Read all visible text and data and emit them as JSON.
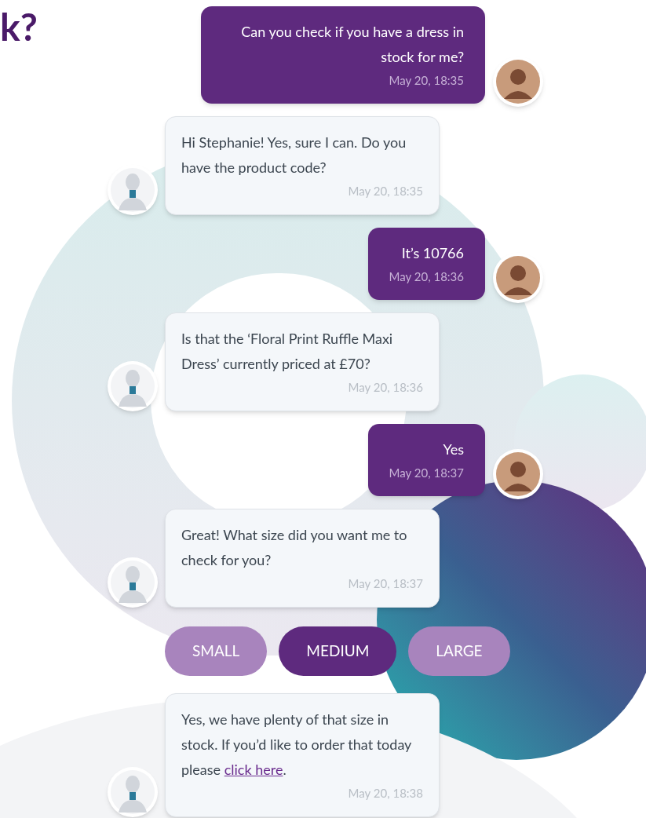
{
  "heading": "k?",
  "messages": [
    {
      "kind": "sent",
      "text": "Can you check if you have a dress in stock for me?",
      "time": "May 20, 18:35"
    },
    {
      "kind": "received",
      "text": "Hi Stephanie! Yes, sure I can. Do you have the product code?",
      "time": "May 20, 18:35"
    },
    {
      "kind": "sent",
      "text": "It’s 10766",
      "time": "May 20, 18:36"
    },
    {
      "kind": "received",
      "text": "Is that the ‘Floral Print Ruffle Maxi Dress’ currently priced at £70?",
      "time": "May 20, 18:36"
    },
    {
      "kind": "sent",
      "text": "Yes",
      "time": "May 20, 18:37"
    },
    {
      "kind": "received",
      "text": "Great! What size did you want me to check for you?",
      "time": "May 20, 18:37"
    }
  ],
  "size_options": [
    {
      "label": "SMALL",
      "selected": false
    },
    {
      "label": "MEDIUM",
      "selected": true
    },
    {
      "label": "LARGE",
      "selected": false
    }
  ],
  "last_message": {
    "kind": "received",
    "text": "Yes, we have plenty of that size in stock. If you’d like to order that today please",
    "link": "click here",
    "text_after": ".",
    "time": "May 20, 18:38"
  }
}
